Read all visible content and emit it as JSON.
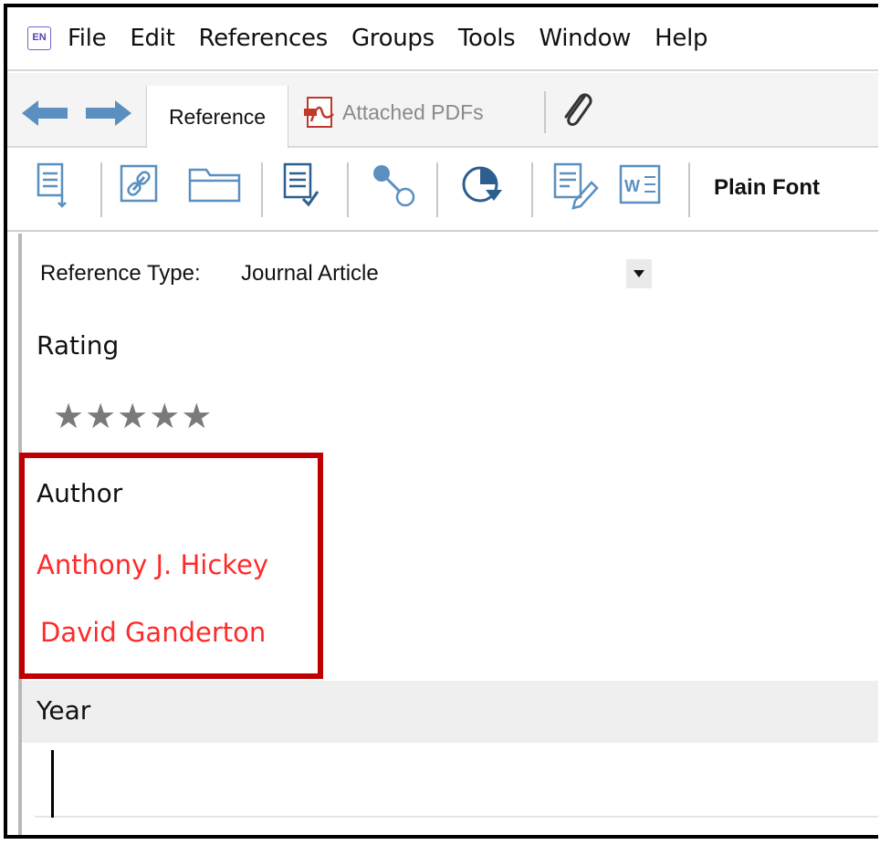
{
  "app": {
    "icon_label": "EN"
  },
  "menu": {
    "items": [
      "File",
      "Edit",
      "References",
      "Groups",
      "Tools",
      "Window",
      "Help"
    ]
  },
  "tabs": {
    "reference_label": "Reference",
    "attached_pdfs_label": "Attached PDFs"
  },
  "toolbar": {
    "font_label": "Plain Font"
  },
  "reference": {
    "type_label": "Reference Type:",
    "type_value": "Journal Article",
    "rating_label": "Rating",
    "rating_stars": "★★★★★",
    "author_label": "Author",
    "authors": [
      "Anthony J. Hickey",
      "David Ganderton"
    ],
    "year_label": "Year",
    "year_value": ""
  },
  "colors": {
    "author_text": "#ff2a2a",
    "highlight_border": "#c00000",
    "arrow": "#5a8fc0"
  }
}
